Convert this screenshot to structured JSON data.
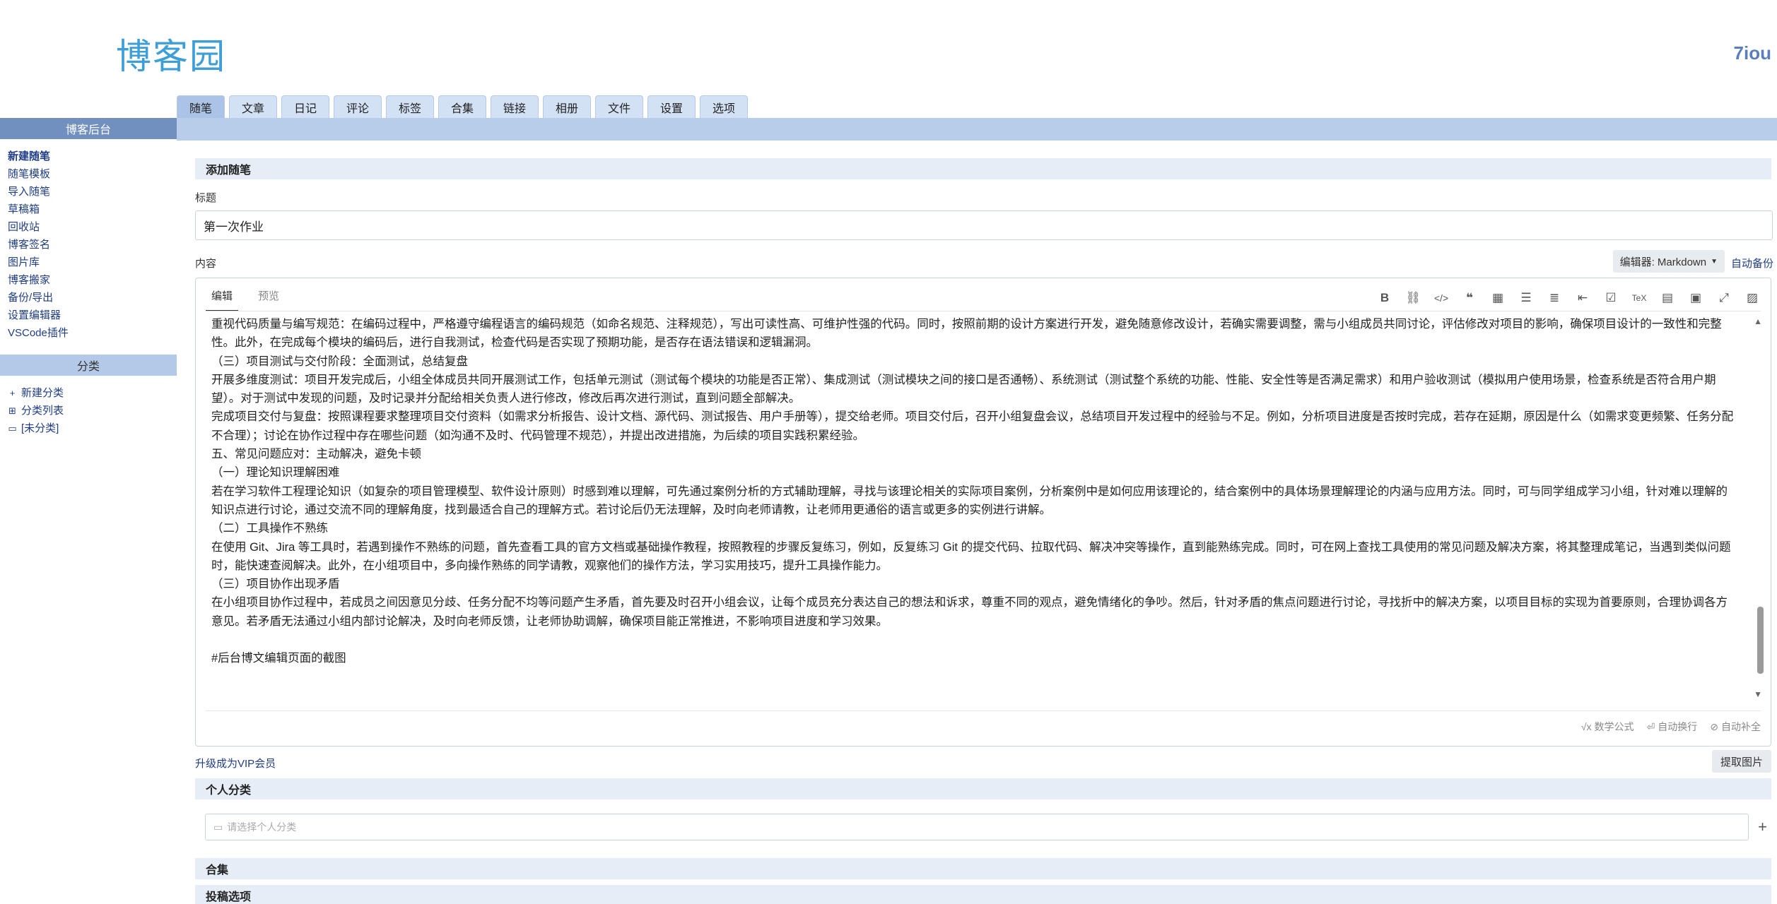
{
  "header": {
    "logo": "博客园",
    "username": "7iou"
  },
  "tabs": [
    {
      "label": "随笔",
      "active": true
    },
    {
      "label": "文章"
    },
    {
      "label": "日记"
    },
    {
      "label": "评论"
    },
    {
      "label": "标签"
    },
    {
      "label": "合集"
    },
    {
      "label": "链接"
    },
    {
      "label": "相册"
    },
    {
      "label": "文件"
    },
    {
      "label": "设置"
    },
    {
      "label": "选项"
    }
  ],
  "sidebar": {
    "heading": "博客后台",
    "links": [
      "新建随笔",
      "随笔模板",
      "导入随笔",
      "草稿箱",
      "回收站",
      "博客签名",
      "图片库",
      "博客搬家",
      "备份/导出",
      "设置编辑器",
      "VSCode插件"
    ],
    "category_heading": "分类",
    "category_items": [
      {
        "icon": "plus-icon",
        "label": "新建分类"
      },
      {
        "icon": "tree-icon",
        "label": "分类列表"
      },
      {
        "icon": "folder-icon",
        "label": "[未分类]"
      }
    ]
  },
  "main": {
    "section_title": "添加随笔",
    "title_label": "标题",
    "title_value": "第一次作业",
    "content_label": "内容",
    "editor_select": "编辑器: Markdown",
    "auto_backup": "自动备份",
    "editor_tabs": [
      "编辑",
      "预览"
    ],
    "toolbar_icons": [
      "bold-icon",
      "link-icon",
      "code-icon",
      "quote-icon",
      "table-icon",
      "bullet-list-icon",
      "numbered-list-icon",
      "indent-icon",
      "checkbox-icon",
      "tex-icon",
      "toc-icon",
      "save-icon",
      "fullscreen-icon",
      "image-icon"
    ],
    "content_lines": [
      "重视代码质量与编写规范：在编码过程中，严格遵守编程语言的编码规范（如命名规范、注释规范），写出可读性高、可维护性强的代码。同时，按照前期的设计方案进行开发，避免随意修改设计，若确实需要调整，需与小组成员共同讨论，评估修改对项目的影响，确保项目设计的一致性和完整性。此外，在完成每个模块的编码后，进行自我测试，检查代码是否实现了预期功能，是否存在语法错误和逻辑漏洞。",
      "（三）项目测试与交付阶段：全面测试，总结复盘",
      "开展多维度测试：项目开发完成后，小组全体成员共同开展测试工作，包括单元测试（测试每个模块的功能是否正常）、集成测试（测试模块之间的接口是否通畅）、系统测试（测试整个系统的功能、性能、安全性等是否满足需求）和用户验收测试（模拟用户使用场景，检查系统是否符合用户期望）。对于测试中发现的问题，及时记录并分配给相关负责人进行修改，修改后再次进行测试，直到问题全部解决。",
      "完成项目交付与复盘：按照课程要求整理项目交付资料（如需求分析报告、设计文档、源代码、测试报告、用户手册等），提交给老师。项目交付后，召开小组复盘会议，总结项目开发过程中的经验与不足。例如，分析项目进度是否按时完成，若存在延期，原因是什么（如需求变更频繁、任务分配不合理）；讨论在协作过程中存在哪些问题（如沟通不及时、代码管理不规范），并提出改进措施，为后续的项目实践积累经验。",
      "五、常见问题应对：主动解决，避免卡顿",
      "（一）理论知识理解困难",
      "若在学习软件工程理论知识（如复杂的项目管理模型、软件设计原则）时感到难以理解，可先通过案例分析的方式辅助理解，寻找与该理论相关的实际项目案例，分析案例中是如何应用该理论的，结合案例中的具体场景理解理论的内涵与应用方法。同时，可与同学组成学习小组，针对难以理解的知识点进行讨论，通过交流不同的理解角度，找到最适合自己的理解方式。若讨论后仍无法理解，及时向老师请教，让老师用更通俗的语言或更多的实例进行讲解。",
      "（二）工具操作不熟练",
      "在使用 Git、Jira 等工具时，若遇到操作不熟练的问题，首先查看工具的官方文档或基础操作教程，按照教程的步骤反复练习，例如，反复练习 Git 的提交代码、拉取代码、解决冲突等操作，直到能熟练完成。同时，可在网上查找工具使用的常见问题及解决方案，将其整理成笔记，当遇到类似问题时，能快速查阅解决。此外，在小组项目中，多向操作熟练的同学请教，观察他们的操作方法，学习实用技巧，提升工具操作能力。",
      "（三）项目协作出现矛盾",
      "在小组项目协作过程中，若成员之间因意见分歧、任务分配不均等问题产生矛盾，首先要及时召开小组会议，让每个成员充分表达自己的想法和诉求，尊重不同的观点，避免情绪化的争吵。然后，针对矛盾的焦点问题进行讨论，寻找折中的解决方案，以项目目标的实现为首要原则，合理协调各方意见。若矛盾无法通过小组内部讨论解决，及时向老师反馈，让老师协助调解，确保项目能正常推进，不影响项目进度和学习效果。",
      "",
      "#后台博文编辑页面的截图"
    ],
    "footer": {
      "math": "数学公式",
      "auto_wrap": "自动换行",
      "auto_complete": "自动补全"
    },
    "vip_link": "升级成为VIP会员",
    "extract_button": "提取图片",
    "personal_category_title": "个人分类",
    "category_placeholder": "请选择个人分类",
    "collection_title": "合集",
    "submit_options_title": "投稿选项"
  }
}
